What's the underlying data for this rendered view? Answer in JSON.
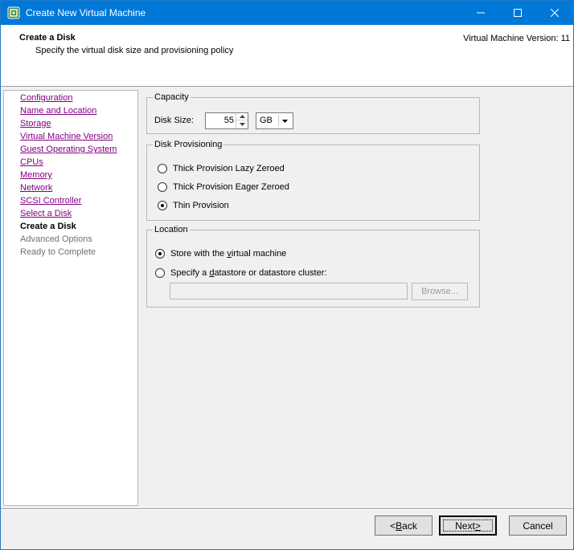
{
  "window": {
    "title": "Create New Virtual Machine",
    "icon": "vmware-logo-icon",
    "title_color": "#0078d7"
  },
  "header": {
    "title": "Create a Disk",
    "subtitle": "Specify the virtual disk size and provisioning policy",
    "version": "Virtual Machine Version: 11"
  },
  "nav": {
    "items": [
      {
        "label": "Configuration",
        "state": "link"
      },
      {
        "label": "Name and Location",
        "state": "link"
      },
      {
        "label": "Storage",
        "state": "link"
      },
      {
        "label": "Virtual Machine Version",
        "state": "link"
      },
      {
        "label": "Guest Operating System",
        "state": "link"
      },
      {
        "label": "CPUs",
        "state": "link"
      },
      {
        "label": "Memory",
        "state": "link"
      },
      {
        "label": "Network",
        "state": "link"
      },
      {
        "label": "SCSI Controller",
        "state": "link"
      },
      {
        "label": "Select a Disk",
        "state": "link"
      },
      {
        "label": "Create a Disk",
        "state": "current"
      },
      {
        "label": "Advanced Options",
        "state": "future"
      },
      {
        "label": "Ready to Complete",
        "state": "future"
      }
    ]
  },
  "capacity": {
    "legend": "Capacity",
    "disk_size_label": "Disk Size:",
    "disk_size_value": "55",
    "unit_value": "GB"
  },
  "provisioning": {
    "legend": "Disk Provisioning",
    "options": [
      {
        "label": "Thick Provision Lazy Zeroed",
        "checked": false
      },
      {
        "label": "Thick Provision Eager Zeroed",
        "checked": false
      },
      {
        "label": "Thin Provision",
        "checked": true
      }
    ]
  },
  "location": {
    "legend": "Location",
    "store_with_vm": {
      "pre": "Store with the ",
      "accel": "v",
      "post": "irtual machine",
      "checked": true
    },
    "specify_datastore": {
      "pre": "Specify a ",
      "accel": "d",
      "post": "atastore or datastore cluster:",
      "checked": false
    },
    "datastore_value": "",
    "browse_label": "Browse..."
  },
  "footer": {
    "back": {
      "accel": "B",
      "pre": "< ",
      "post": "ack"
    },
    "next": {
      "pre": "Next ",
      "accel": ">",
      "post": ""
    },
    "cancel": "Cancel"
  }
}
